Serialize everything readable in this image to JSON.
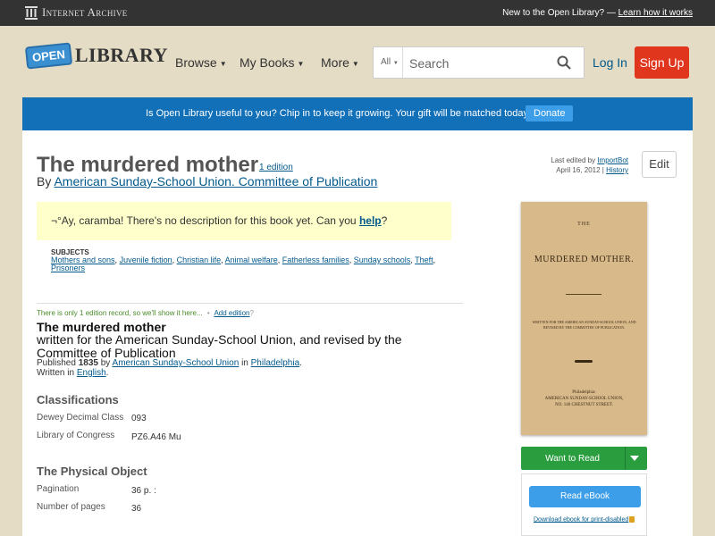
{
  "ia": {
    "logo_text": "Internet Archive",
    "new_text": "New to the Open Library? —",
    "learn_link": "Learn how it works"
  },
  "header": {
    "logo_open": "OPEN",
    "logo_library": "LIBRARY",
    "nav": [
      "Browse",
      "My Books",
      "More"
    ],
    "search_scope": "All",
    "search_placeholder": "Search",
    "login": "Log In",
    "signup": "Sign Up"
  },
  "banner": {
    "text": "Is Open Library useful to you? Chip in to keep it growing. Your gift will be matched today!",
    "donate": "Donate"
  },
  "work": {
    "title": "The murdered mother",
    "editions_link": "1 edition",
    "by_prefix": "By",
    "author": "American Sunday-School Union. Committee of Publication",
    "last_edited_prefix": "Last edited by",
    "last_edited_by": "ImportBot",
    "last_edited_date": "April 16, 2012 |",
    "history_link": "History",
    "edit_button": "Edit",
    "no_description": "¬°Ay, caramba! There's no description for this book yet. Can you",
    "help_link": "help",
    "help_suffix": "?",
    "subjects_heading": "SUBJECTS",
    "subjects": [
      "Mothers and sons",
      "Juvenile fiction",
      "Christian life",
      "Animal welfare",
      "Fatherless families",
      "Sunday schools",
      "Theft",
      "Prisoners"
    ]
  },
  "edition": {
    "only_one_text": "There is only 1 edition record, so we'll show it here...",
    "bullet": "•",
    "add_edition": "Add edition",
    "add_edition_suffix": "?",
    "title": "The murdered mother",
    "subtitle": "written for the American Sunday-School Union, and revised by the Committee of Publication",
    "published_prefix": "Published",
    "year": "1835",
    "published_by": "by",
    "publisher": "American Sunday-School Union",
    "in_word": "in",
    "place": "Philadelphia",
    "written_in_prefix": "Written in",
    "language": "English"
  },
  "classifications": {
    "heading": "Classifications",
    "dewey_label": "Dewey Decimal Class",
    "dewey_value": "093",
    "loc_label": "Library of Congress",
    "loc_value": "PZ6.A46 Mu"
  },
  "physical": {
    "heading": "The Physical Object",
    "pagination_label": "Pagination",
    "pagination_value": "36 p. :",
    "pages_label": "Number of pages",
    "pages_value": "36"
  },
  "cover": {
    "line1": "THE",
    "line2": "MURDERED MOTHER.",
    "line3": "WRITTEN FOR THE AMERICAN SUNDAY-SCHOOL UNION, AND REVISED BY THE COMMITTEE OF PUBLICATION.",
    "line4": "Philadelphia:",
    "line5": "AMERICAN SUNDAY-SCHOOL UNION,",
    "line6": "NO. 146 CHESTNUT STREET."
  },
  "actions": {
    "want_to_read": "Want to Read",
    "read_ebook": "Read eBook",
    "download": "Download ebook for print-disabled"
  }
}
